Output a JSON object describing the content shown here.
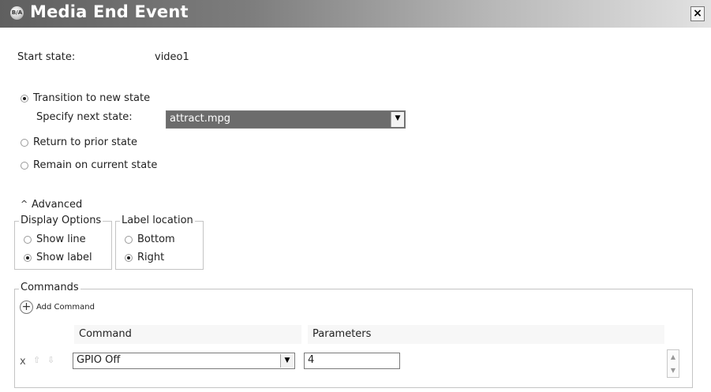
{
  "window": {
    "title": "Media End Event",
    "icon_text": "B/A",
    "close_label": "×"
  },
  "start_state": {
    "label": "Start state:",
    "value": "video1"
  },
  "transition": {
    "options": [
      {
        "label": "Transition to new state",
        "selected": true
      },
      {
        "label": "Return to prior state",
        "selected": false
      },
      {
        "label": "Remain on current state",
        "selected": false
      }
    ],
    "next_state_label": "Specify next state:",
    "next_state_value": "attract.mpg"
  },
  "advanced": {
    "toggle_glyph": "^",
    "label": "Advanced",
    "display_options": {
      "legend": "Display Options",
      "options": [
        {
          "label": "Show line",
          "selected": false
        },
        {
          "label": "Show label",
          "selected": true
        }
      ]
    },
    "label_location": {
      "legend": "Label location",
      "options": [
        {
          "label": "Bottom",
          "selected": false
        },
        {
          "label": "Right",
          "selected": true
        }
      ]
    }
  },
  "commands": {
    "legend": "Commands",
    "add_label": "Add Command",
    "columns": [
      "Command",
      "Parameters"
    ],
    "rows": [
      {
        "delete": "x",
        "command": "GPIO Off",
        "parameters": "4"
      }
    ]
  },
  "icons": {
    "combo_arrow": "▼",
    "move_up": "⇧",
    "move_down": "⇩",
    "scroll_up": "▲",
    "scroll_down": "▼",
    "plus": "+"
  }
}
